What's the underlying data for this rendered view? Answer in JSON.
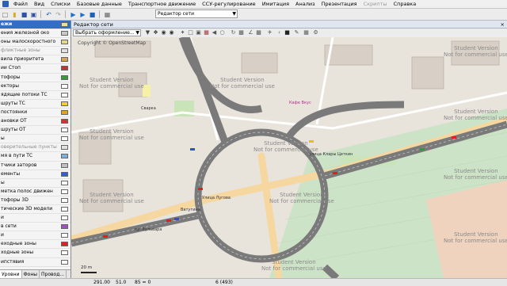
{
  "menubar": {
    "items": [
      {
        "label": "Файл",
        "disabled": false
      },
      {
        "label": "Вид",
        "disabled": false
      },
      {
        "label": "Списки",
        "disabled": false
      },
      {
        "label": "Базовые данные",
        "disabled": false
      },
      {
        "label": "Транспортное движение",
        "disabled": false
      },
      {
        "label": "ССУ-регулирование",
        "disabled": false
      },
      {
        "label": "Имитация",
        "disabled": false
      },
      {
        "label": "Анализ",
        "disabled": false
      },
      {
        "label": "Презентация",
        "disabled": false
      },
      {
        "label": "Скрипты",
        "disabled": true
      },
      {
        "label": "Справка",
        "disabled": false
      }
    ]
  },
  "toolbar": {
    "view_combo_value": "Редактор сети"
  },
  "editor": {
    "title": "Редактор сети",
    "close_glyph": "×",
    "layout_combo_value": "Выбрать оформление..."
  },
  "layers": [
    {
      "label": "ежи",
      "selected": true,
      "dim": false,
      "color": "#f2e08a"
    },
    {
      "label": "ения железной око",
      "selected": false,
      "dim": false,
      "color": "#c8c8c8"
    },
    {
      "label": "оны малоскоростного",
      "selected": false,
      "dim": false,
      "color": "#e6d68a"
    },
    {
      "label": "фликтные зоны",
      "selected": false,
      "dim": true,
      "color": "#e0e0e0"
    },
    {
      "label": "вила приоритета",
      "selected": false,
      "dim": false,
      "color": "#d9a34a"
    },
    {
      "label": "ии Стоп",
      "selected": false,
      "dim": false,
      "color": "#c83232"
    },
    {
      "label": "тофоры",
      "selected": false,
      "dim": false,
      "color": "#3a9a3a"
    },
    {
      "label": "екторы",
      "selected": false,
      "dim": false,
      "color": "#ffffff"
    },
    {
      "label": "ядящие потоки ТС",
      "selected": false,
      "dim": false,
      "color": "#ffffff"
    },
    {
      "label": "шруты ТС",
      "selected": false,
      "dim": false,
      "color": "#f0d030"
    },
    {
      "label": "постоянки",
      "selected": false,
      "dim": false,
      "color": "#e8a020"
    },
    {
      "label": "ановки ОТ",
      "selected": false,
      "dim": false,
      "color": "#d83030"
    },
    {
      "label": "шруты ОТ",
      "selected": false,
      "dim": false,
      "color": "#ffffff"
    },
    {
      "label": "ы",
      "selected": false,
      "dim": false,
      "color": "#ffffff"
    },
    {
      "label": "оверительные пункты",
      "selected": false,
      "dim": true,
      "color": "#e0e0e0"
    },
    {
      "label": "мя в пути ТС",
      "selected": false,
      "dim": false,
      "color": "#7fb0e0"
    },
    {
      "label": "тчики заторов",
      "selected": false,
      "dim": false,
      "color": "#c0c0c0"
    },
    {
      "label": "ементы",
      "selected": false,
      "dim": false,
      "color": "#3060d0"
    },
    {
      "label": "ы",
      "selected": false,
      "dim": false,
      "color": "#ffffff"
    },
    {
      "label": "метка полос движен",
      "selected": false,
      "dim": false,
      "color": "#ffffff"
    },
    {
      "label": "тофоры 3D",
      "selected": false,
      "dim": false,
      "color": "#ffffff"
    },
    {
      "label": "тические 3D модели",
      "selected": false,
      "dim": false,
      "color": "#ffffff"
    },
    {
      "label": "и",
      "selected": false,
      "dim": false,
      "color": "#ffffff"
    },
    {
      "label": "в сети",
      "selected": false,
      "dim": false,
      "color": "#a050c0"
    },
    {
      "label": "и",
      "selected": false,
      "dim": false,
      "color": "#ffffff"
    },
    {
      "label": "еходные зоны",
      "selected": false,
      "dim": false,
      "color": "#e02020"
    },
    {
      "label": "ходные зоны",
      "selected": false,
      "dim": false,
      "color": "#ffffff"
    },
    {
      "label": "ипстявия",
      "selected": false,
      "dim": false,
      "color": "#ffffff"
    }
  ],
  "panel_tabs": [
    "Уровни",
    "Фоны",
    "Провод..."
  ],
  "statusbar": {
    "field1": "291.00",
    "field2": "51.0",
    "field3": "85 = 0",
    "field4": "6 (493)"
  },
  "map": {
    "credit": "Copyright © OpenStreetMap",
    "watermark_line1": "Student Version",
    "watermark_line2": "Not for commercial use",
    "streets": [
      "улица Клары Цеткин",
      "Улица Лугова",
      "Ватутина",
      "пр. Бульвара"
    ],
    "scale_label": "20 m",
    "poi_labels": [
      "Кафе Вкус",
      "Сварка"
    ]
  }
}
